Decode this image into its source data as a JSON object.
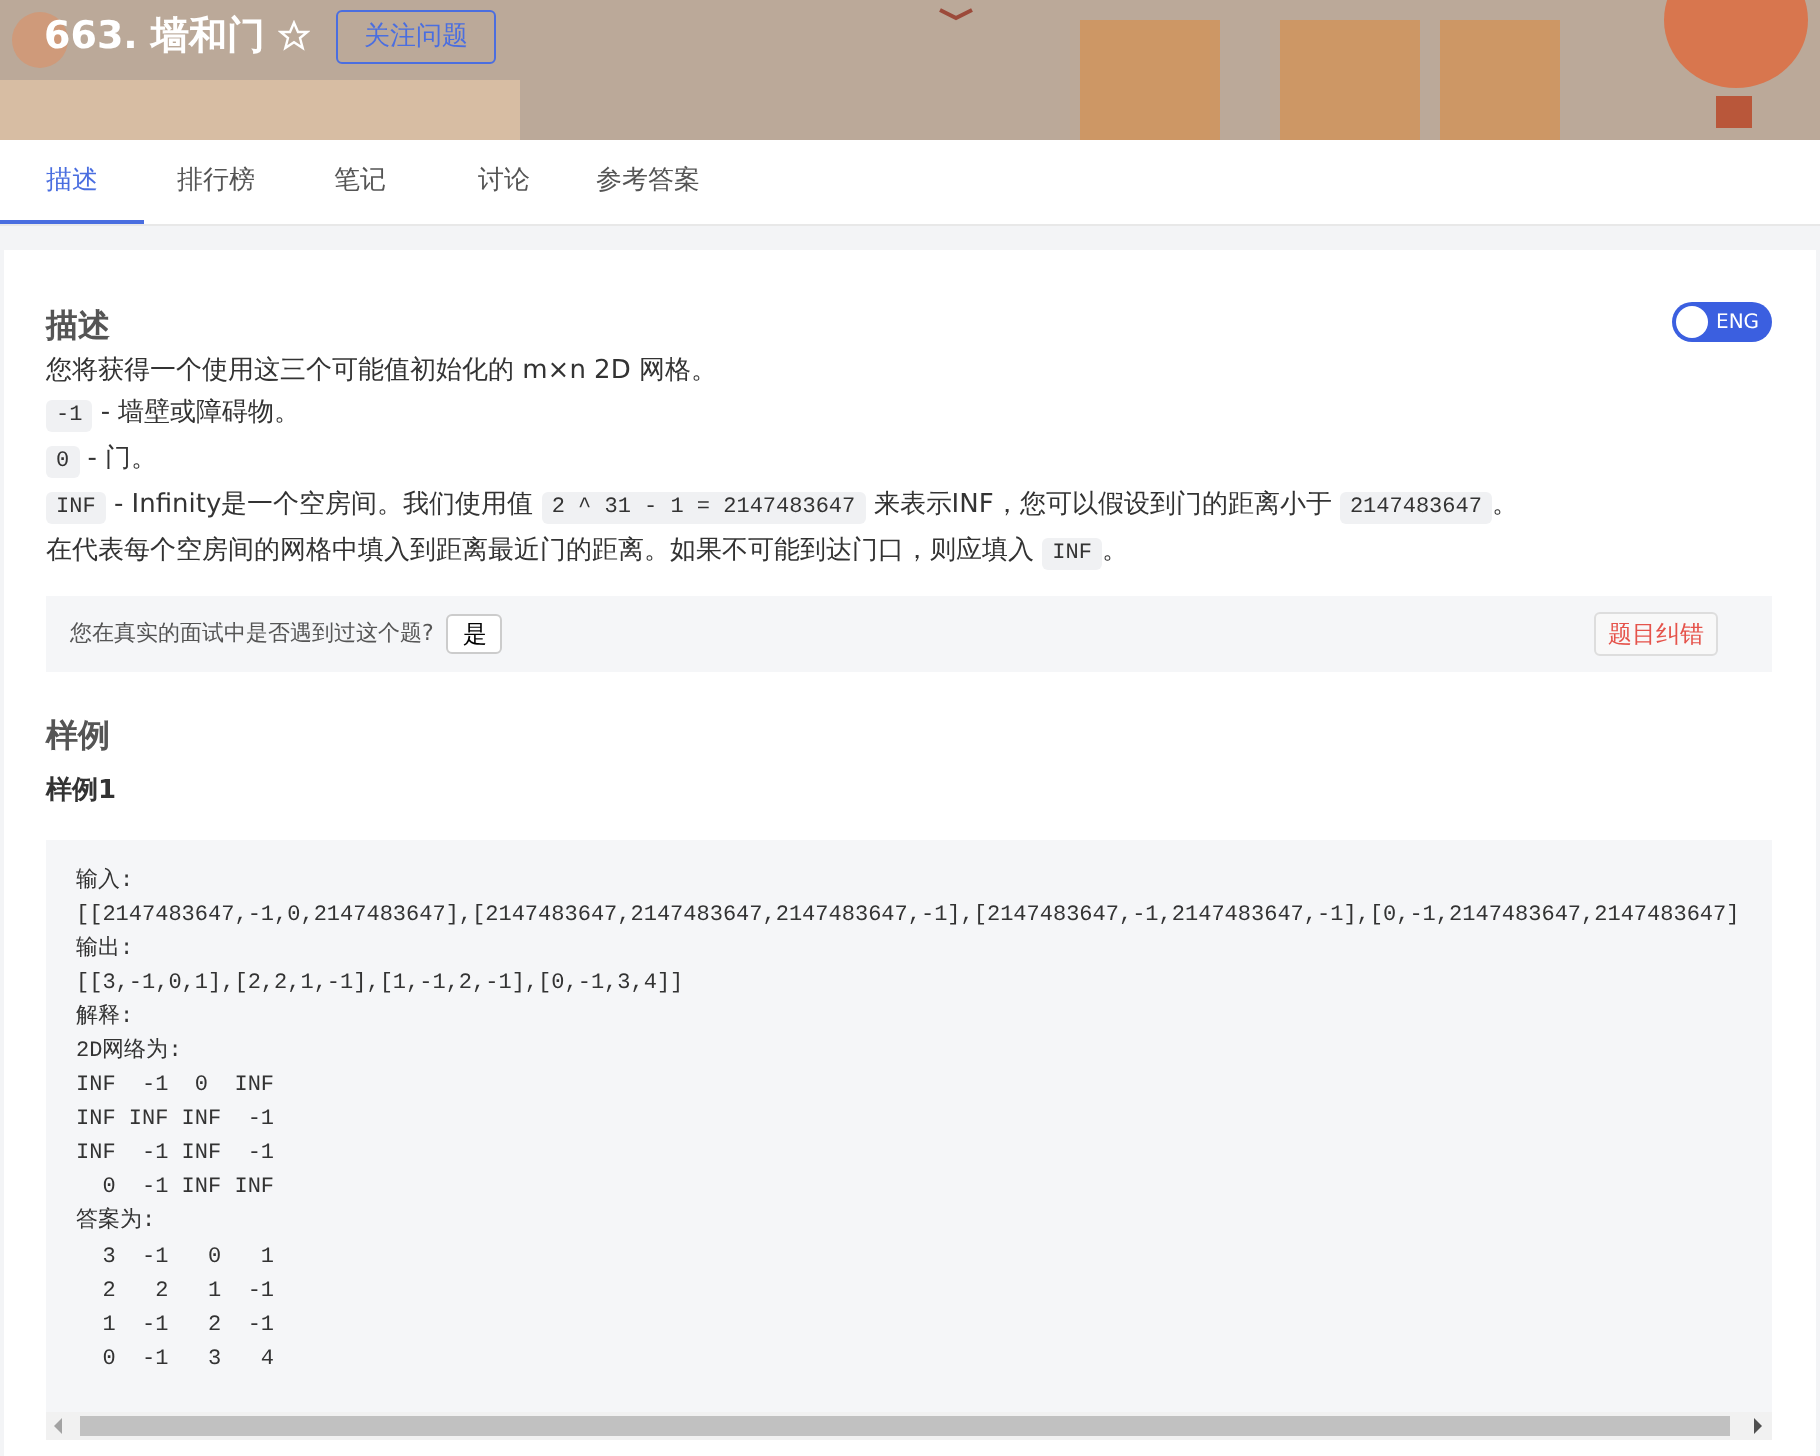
{
  "header": {
    "title": "663. 墙和门",
    "follow_button": "关注问题"
  },
  "tabs": [
    {
      "label": "描述",
      "selected": true
    },
    {
      "label": "排行榜",
      "selected": false
    },
    {
      "label": "笔记",
      "selected": false
    },
    {
      "label": "讨论",
      "selected": false
    },
    {
      "label": "参考答案",
      "selected": false
    }
  ],
  "description": {
    "heading": "描述",
    "language_toggle": {
      "label": "ENG"
    },
    "lines": [
      [
        {
          "kind": "text",
          "text": "您将获得一个使用这三个可能值初始化的 m×n 2D 网格。"
        }
      ],
      [
        {
          "kind": "code",
          "text": "-1"
        },
        {
          "kind": "text",
          "text": " - 墙壁或障碍物。"
        }
      ],
      [
        {
          "kind": "code",
          "text": "0"
        },
        {
          "kind": "text",
          "text": " - 门。"
        }
      ],
      [
        {
          "kind": "code",
          "text": "INF"
        },
        {
          "kind": "text",
          "text": " - Infinity是一个空房间。我们使用值 "
        },
        {
          "kind": "code",
          "text": "2 ^ 31 - 1 = 2147483647"
        },
        {
          "kind": "text",
          "text": " 来表示INF，您可以假设到门的距离小于 "
        },
        {
          "kind": "code",
          "text": "2147483647"
        },
        {
          "kind": "text",
          "text": "。"
        }
      ],
      [
        {
          "kind": "text",
          "text": "在代表每个空房间的网格中填入到距离最近门的距离。如果不可能到达门口，则应填入 "
        },
        {
          "kind": "code",
          "text": "INF"
        },
        {
          "kind": "text",
          "text": "。"
        }
      ]
    ]
  },
  "interview_bar": {
    "question": "您在真实的面试中是否遇到过这个题?",
    "answer_button": "是",
    "report_button": "题目纠错"
  },
  "examples": {
    "heading": "样例",
    "items": [
      {
        "title": "样例1",
        "code_lines": [
          "输入:",
          "[[2147483647,-1,0,2147483647],[2147483647,2147483647,2147483647,-1],[2147483647,-1,2147483647,-1],[0,-1,2147483647,2147483647]",
          "输出:",
          "[[3,-1,0,1],[2,2,1,-1],[1,-1,2,-1],[0,-1,3,4]]",
          "解释:",
          "2D网络为:",
          "INF  -1  0  INF",
          "INF INF INF  -1",
          "INF  -1 INF  -1",
          "  0  -1 INF INF",
          "答案为:",
          "  3  -1   0   1",
          "  2   2   1  -1",
          "  1  -1   2  -1",
          "  0  -1   3   4"
        ]
      }
    ]
  }
}
